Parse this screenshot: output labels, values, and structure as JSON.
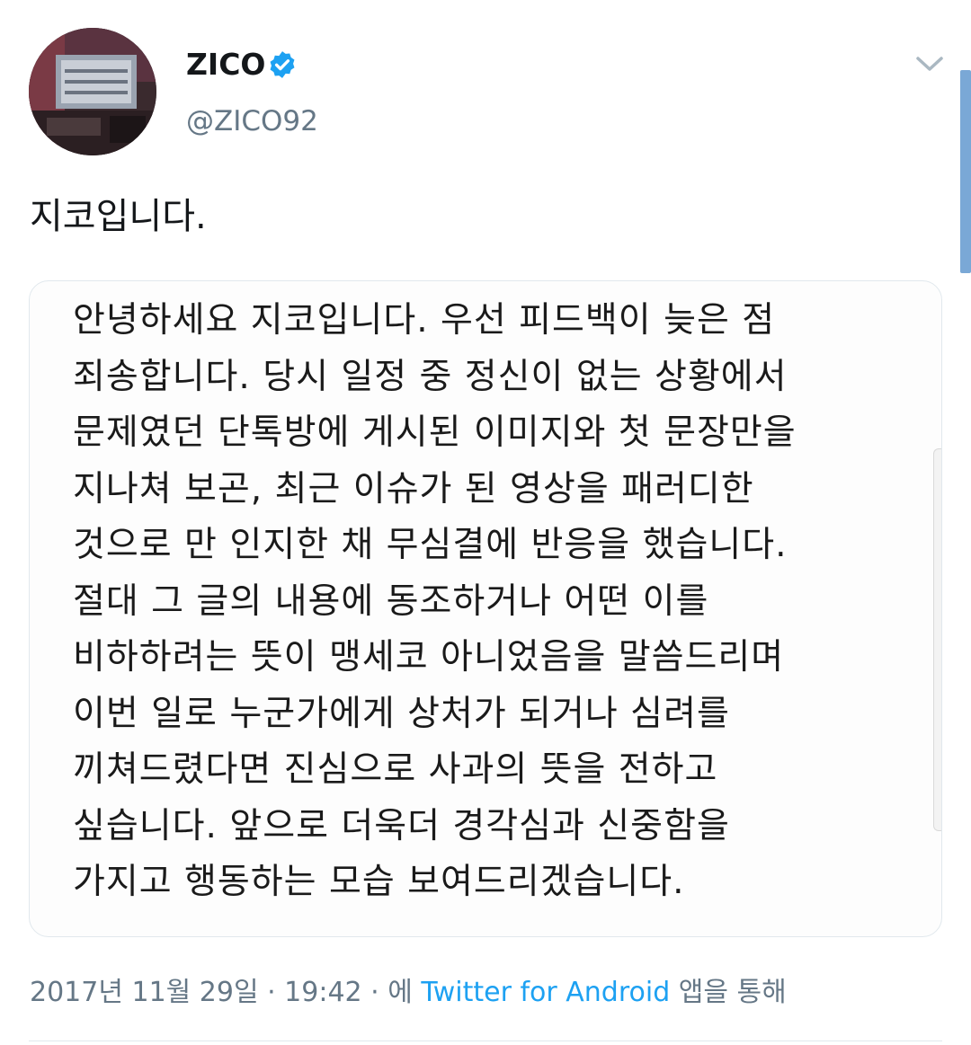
{
  "tweet": {
    "author": {
      "display_name": "ZICO",
      "handle": "@ZICO92",
      "verified": true,
      "avatar_icon": "avatar-studio-photo"
    },
    "text": "지코입니다.",
    "image_text_lines": [
      "안녕하세요 지코입니다. 우선 피드백이 늦은 점",
      "죄송합니다. 당시 일정 중 정신이 없는 상황에서",
      "문제였던 단톡방에 게시된 이미지와 첫 문장만을",
      "지나쳐 보곤, 최근 이슈가 된 영상을 패러디한",
      "것으로 만 인지한 채 무심결에 반응을 했습니다.",
      "절대 그 글의 내용에 동조하거나 어떤 이를",
      "비하하려는 뜻이 맹세코 아니었음을 말씀드리며",
      "이번 일로 누군가에게 상처가 되거나 심려를",
      "끼쳐드렸다면 진심으로 사과의 뜻을 전하고",
      "싶습니다. 앞으로 더욱더 경각심과 신중함을",
      "가지고 행동하는 모습 보여드리겠습니다."
    ],
    "timestamp": "2017년 11월 29일 · 19:42 · 에",
    "source": "Twitter for Android",
    "source_suffix": "앱을 통해"
  },
  "colors": {
    "verified": "#1da1f2",
    "link": "#1da1f2",
    "muted": "#657786"
  }
}
